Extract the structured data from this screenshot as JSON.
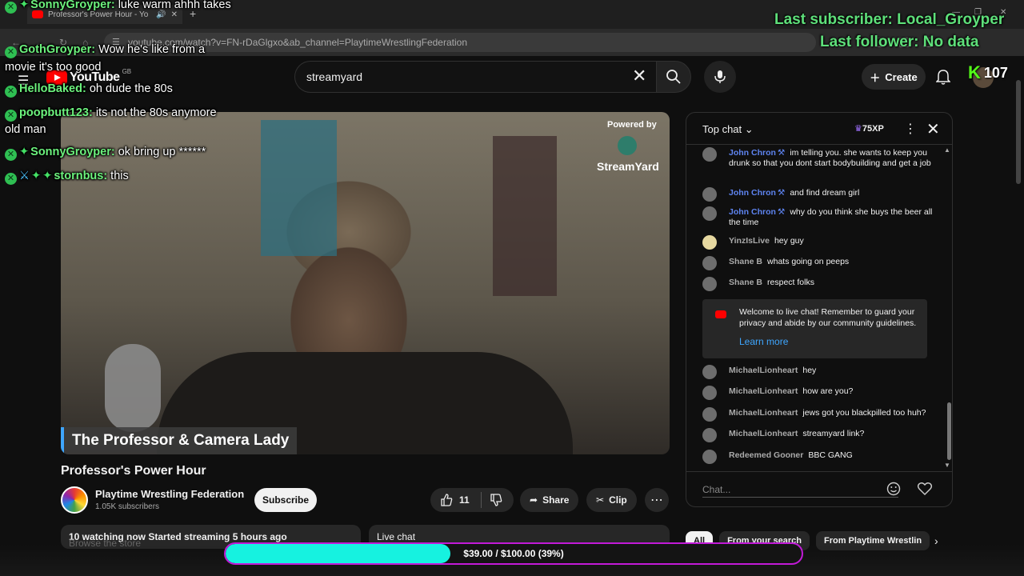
{
  "browser": {
    "tab_title": "Professor's Power Hour - Yo",
    "new_tab": "+",
    "url": "youtube.com/watch?v=FN-rDaGlgxo&ab_channel=PlaytimeWrestlingFederation"
  },
  "masthead": {
    "logo": "YouTube",
    "region": "GB",
    "search_value": "streamyard",
    "create_label": "Create"
  },
  "video": {
    "lower_third": "The Professor & Camera Lady",
    "powered_by": "Powered by",
    "streamyard": "StreamYard",
    "title": "Professor's Power Hour"
  },
  "channel": {
    "name": "Playtime Wrestling Federation",
    "subscribers": "1.05K subscribers",
    "subscribe_label": "Subscribe"
  },
  "actions": {
    "likes": "11",
    "share": "Share",
    "clip": "Clip"
  },
  "description": {
    "stats": "10 watching now  Started streaming 5 hours ago",
    "live_chat": "Live chat",
    "browse_store": "Browse the store"
  },
  "chat": {
    "header": "Top chat",
    "xp": "75XP",
    "messages": [
      {
        "author": "John Chron",
        "mod": true,
        "text": "im telling you. she wants to keep you drunk so that you dont start bodybuilding and get a job"
      },
      {
        "author": "John Chron",
        "mod": true,
        "text": "and find dream girl"
      },
      {
        "author": "John Chron",
        "mod": true,
        "text": "why do you think she buys the beer all the time"
      },
      {
        "author": "YinzIsLive",
        "mod": false,
        "text": "hey guy"
      },
      {
        "author": "Shane B",
        "mod": false,
        "text": "whats going on peeps"
      },
      {
        "author": "Shane B",
        "mod": false,
        "text": "respect folks"
      },
      {
        "author": "MichaelLionheart",
        "mod": false,
        "text": "hey"
      },
      {
        "author": "MichaelLionheart",
        "mod": false,
        "text": "how are you?"
      },
      {
        "author": "MichaelLionheart",
        "mod": false,
        "text": "jews got you blackpilled too huh?"
      },
      {
        "author": "MichaelLionheart",
        "mod": false,
        "text": "streamyard link?"
      },
      {
        "author": "Redeemed Gooner",
        "mod": false,
        "text": "BBC GANG"
      }
    ],
    "welcome_text": "Welcome to live chat! Remember to guard your privacy and abide by our community guidelines.",
    "learn_more": "Learn more",
    "input_placeholder": "Chat..."
  },
  "chips": [
    "All",
    "From your search",
    "From Playtime Wrestlin"
  ],
  "overlay": {
    "chat": [
      {
        "user": "SonnyGroyper",
        "badges": [
          "x",
          "g"
        ],
        "text": "luke warm ahhh takes"
      },
      {
        "user": "GothGroyper",
        "badges": [
          "x"
        ],
        "text": "Wow he's like from a"
      },
      {
        "user": "",
        "badges": [],
        "text": "movie it's too good"
      },
      {
        "user": "HelloBaked",
        "badges": [
          "x"
        ],
        "text": "oh dude the 80s"
      },
      {
        "user": "poopbutt123",
        "badges": [
          "x"
        ],
        "text": "its not the 80s anymore"
      },
      {
        "user": "",
        "badges": [],
        "text": "old man"
      },
      {
        "user": "SonnyGroyper",
        "badges": [
          "x",
          "g"
        ],
        "text": "ok bring up ******"
      },
      {
        "user": "stornbus",
        "badges": [
          "x",
          "b",
          "g",
          "g"
        ],
        "text": "this"
      }
    ],
    "last_subscriber": "Last subscriber: Local_Groyper",
    "last_follower": "Last follower: No data",
    "kick_logo": "K",
    "kick_viewers": "107"
  },
  "goal": {
    "text": "$39.00 / $100.00 (39%)",
    "progress": 0.39
  },
  "colors": {
    "yt_red": "#ff0000",
    "mod_blue": "#5e84f1",
    "overlay_green": "#5ee07a",
    "goal_fill": "#16f2e0",
    "goal_border": "#c21ad8"
  }
}
